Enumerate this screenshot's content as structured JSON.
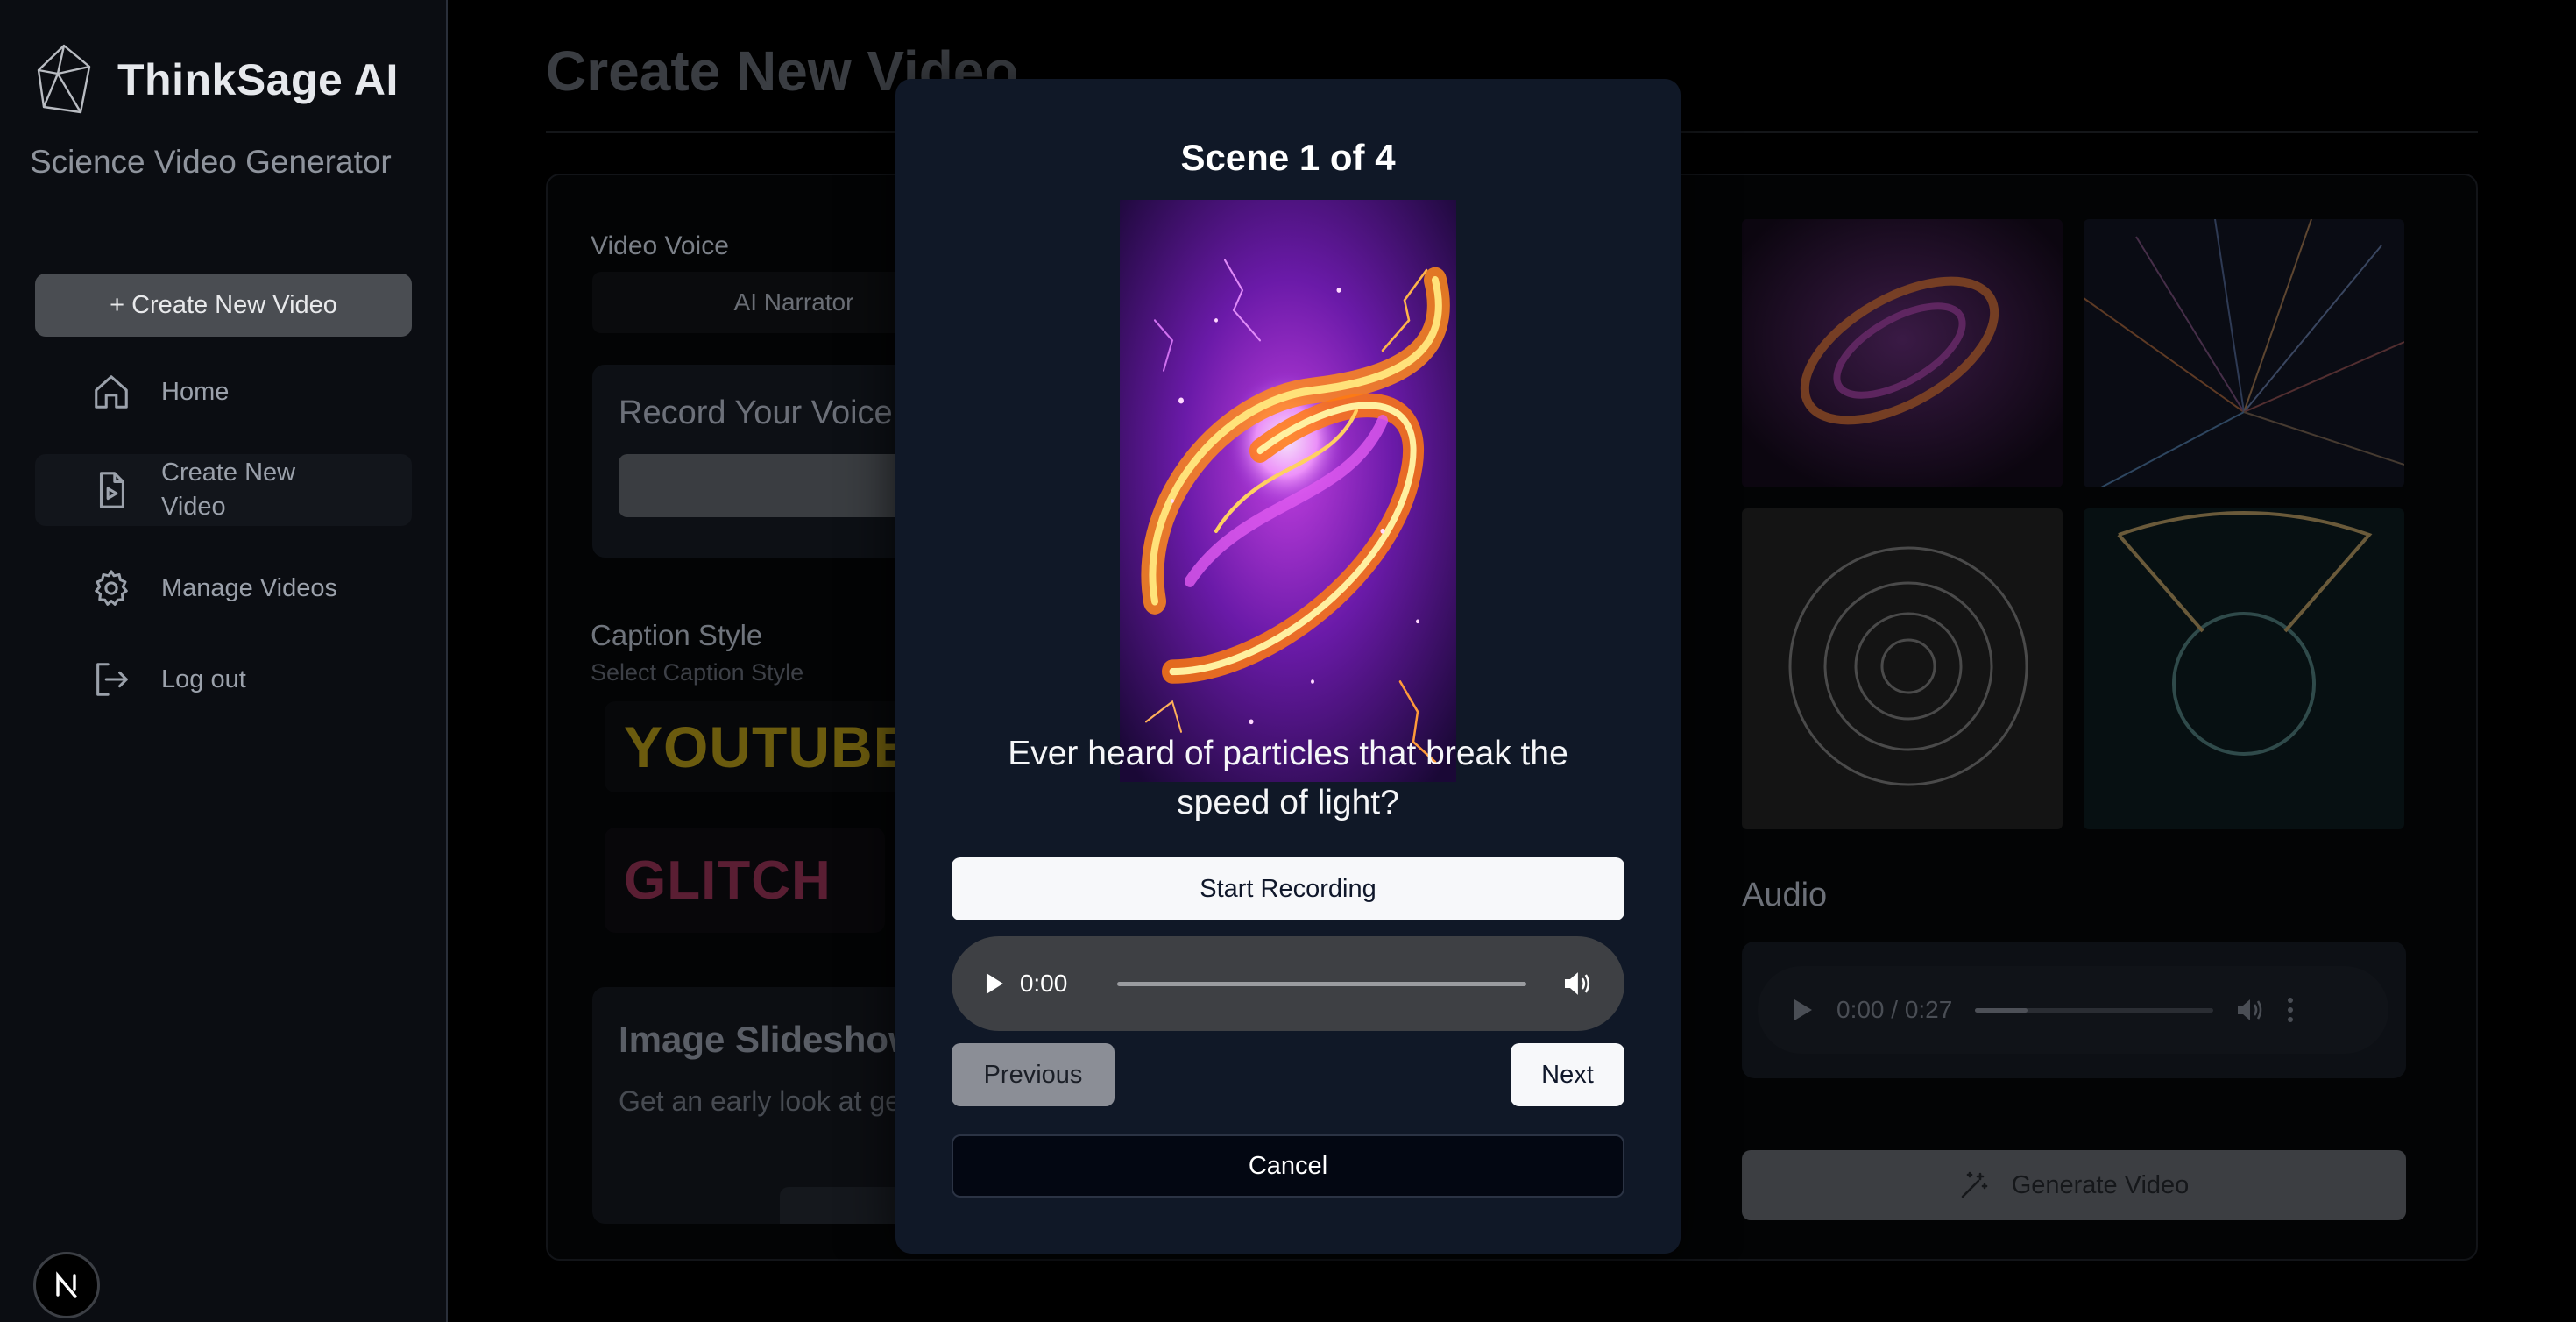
{
  "sidebar": {
    "brand": "ThinkSage AI",
    "subtitle": "Science Video Generator",
    "create_button": "+ Create New Video",
    "nav": [
      {
        "label": "Home",
        "icon": "home-icon"
      },
      {
        "label": "Create New Video",
        "icon": "video-file-icon"
      },
      {
        "label": "Manage Videos",
        "icon": "gear-icon"
      },
      {
        "label": "Log out",
        "icon": "logout-icon"
      }
    ]
  },
  "main": {
    "title": "Create New Video",
    "voice_label": "Video Voice",
    "voice_value": "AI Narrator",
    "record_title": "Record Your Voice",
    "caption_label": "Caption Style",
    "caption_sub": "Select Caption Style",
    "caption_youtube": "YOUTUBE",
    "caption_glitch": "GLITCH",
    "slideshow_title": "Image Slideshow",
    "slideshow_desc": "Get an early look at generating the final",
    "audio_title": "Audio",
    "audio_time": "0:00 / 0:27",
    "audio_progress": 0.22,
    "generate_label": "Generate Video"
  },
  "modal": {
    "title": "Scene 1 of 4",
    "scene_text": "Ever heard of particles that break the speed of light?",
    "start_recording": "Start Recording",
    "player_time": "0:00",
    "previous": "Previous",
    "next": "Next",
    "cancel": "Cancel"
  },
  "colors": {
    "modal_bg": "#101827",
    "accent_glow": "#f5a623",
    "purple": "#a030d0"
  }
}
